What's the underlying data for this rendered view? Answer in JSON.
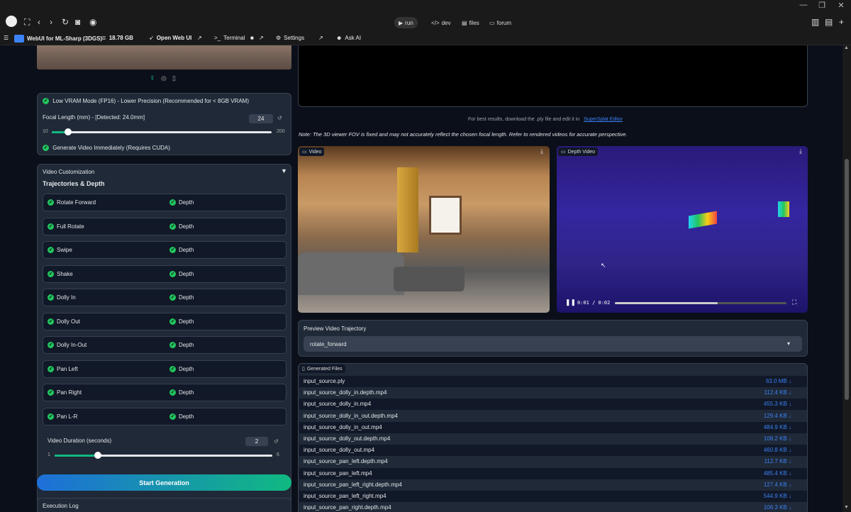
{
  "window": {
    "minimize": "—",
    "restore": "❐",
    "close": "✕"
  },
  "toolbar": {
    "tabs": [
      {
        "label": "run",
        "icon": "play-icon"
      },
      {
        "label": "dev",
        "icon": "code-icon"
      },
      {
        "label": "files",
        "icon": "file-icon"
      },
      {
        "label": "forum",
        "icon": "chat-icon"
      }
    ]
  },
  "navbar": {
    "app_title": "WebUI for ML-Sharp (3DGS)",
    "disk": "18.78 GB",
    "open_web_ui": "Open Web UI",
    "terminal": "Terminal",
    "settings": "Settings",
    "ask_ai": "Ask AI"
  },
  "settings_panel": {
    "low_vram": "Low VRAM Mode (FP16) - Lower Precision (Recommended for < 8GB VRAM)",
    "focal_label": "Focal Length (mm) - [Detected: 24.0mm]",
    "focal_value": "24",
    "focal_min": "10",
    "focal_max": "200",
    "focal_fraction": 0.074,
    "gen_video": "Generate Video Immediately (Requires CUDA)"
  },
  "video_customization": {
    "header": "Video Customization",
    "subheader": "Trajectories & Depth",
    "trajectories": [
      {
        "name": "Rotate Forward",
        "depth": "Depth"
      },
      {
        "name": "Full Rotate",
        "depth": "Depth"
      },
      {
        "name": "Swipe",
        "depth": "Depth"
      },
      {
        "name": "Shake",
        "depth": "Depth"
      },
      {
        "name": "Dolly In",
        "depth": "Depth"
      },
      {
        "name": "Dolly Out",
        "depth": "Depth"
      },
      {
        "name": "Dolly In-Out",
        "depth": "Depth"
      },
      {
        "name": "Pan Left",
        "depth": "Depth"
      },
      {
        "name": "Pan Right",
        "depth": "Depth"
      },
      {
        "name": "Pan L-R",
        "depth": "Depth"
      }
    ],
    "duration_label": "Video Duration (seconds)",
    "duration_value": "2",
    "duration_min": "1",
    "duration_max": "6",
    "duration_fraction": 0.2
  },
  "start_button": "Start Generation",
  "execution_log": "Execution Log",
  "viewer": {
    "hint_prefix": "For best results, download the .ply file and edit it in",
    "hint_link": "SuperSplat Editor",
    "note": "Note: The 3D viewer FOV is fixed and may not accurately reflect the chosen focal length. Refer to rendered videos for accurate perspective."
  },
  "video": {
    "label": "Video"
  },
  "depth_video": {
    "label": "Depth Video",
    "time": "0:01 / 0:02",
    "progress": 0.6
  },
  "preview": {
    "label": "Preview Video Trajectory",
    "selected": "rotate_forward"
  },
  "files": {
    "label": "Generated Files",
    "rows": [
      {
        "name": "input_source.ply",
        "size": "63.0 MB ↓"
      },
      {
        "name": "input_source_dolly_in.depth.mp4",
        "size": "112.4 KB ↓"
      },
      {
        "name": "input_source_dolly_in.mp4",
        "size": "455.3 KB ↓"
      },
      {
        "name": "input_source_dolly_in_out.depth.mp4",
        "size": "129.4 KB ↓"
      },
      {
        "name": "input_source_dolly_in_out.mp4",
        "size": "484.9 KB ↓"
      },
      {
        "name": "input_source_dolly_out.depth.mp4",
        "size": "108.2 KB ↓"
      },
      {
        "name": "input_source_dolly_out.mp4",
        "size": "460.8 KB ↓"
      },
      {
        "name": "input_source_pan_left.depth.mp4",
        "size": "112.7 KB ↓"
      },
      {
        "name": "input_source_pan_left.mp4",
        "size": "485.4 KB ↓"
      },
      {
        "name": "input_source_pan_left_right.depth.mp4",
        "size": "127.4 KB ↓"
      },
      {
        "name": "input_source_pan_left_right.mp4",
        "size": "544.9 KB ↓"
      },
      {
        "name": "input_source_pan_right.depth.mp4",
        "size": "106.3 KB ↓"
      }
    ]
  }
}
